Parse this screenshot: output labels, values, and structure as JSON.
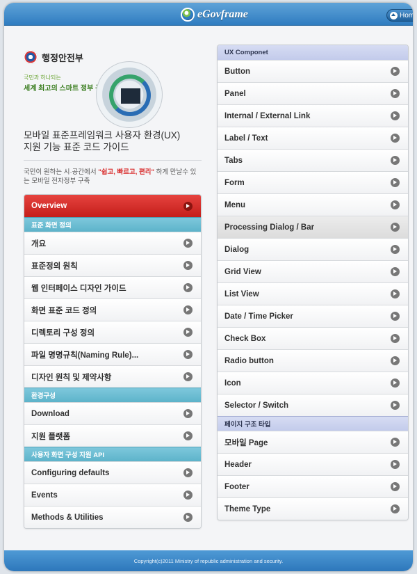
{
  "header": {
    "brand": "eGovframe",
    "home_label": "Home"
  },
  "intro": {
    "ministry": "행정안전부",
    "slogan_small": "국민과 하나되는",
    "slogan_main": "세계 최고의 스마트 정부 구현",
    "title_line1": "모바일 표준프레임워크 사용자 환경(UX)",
    "title_line2": "지원 기능 표준 코드 가이드",
    "desc_prefix": "국민이 원하는 시·공간에서 ",
    "desc_highlight": "\"쉽고, 빠르고, 편리\"",
    "desc_suffix": " 하게 만날수 있는 모바일 전자정부 구축"
  },
  "left_menu": {
    "overview": "Overview",
    "section1": "표준 화면 정의",
    "section1_items": [
      "개요",
      "표준정의 원칙",
      "웹 인터페이스 디자인 가이드",
      "화면 표준 코드 정의",
      "디렉토리 구성 정의",
      "파일 명명규칙(Naming Rule)...",
      "디자인 원칙 및 제약사항"
    ],
    "section2": "환경구성",
    "section2_items": [
      "Download",
      "지원 플랫폼"
    ],
    "section3": "사용자 화면 구성 지원 API",
    "section3_items": [
      "Configuring defaults",
      "Events",
      "Methods & Utilities"
    ]
  },
  "right_menu": {
    "section1": "UX Componet",
    "section1_items": [
      "Button",
      "Panel",
      "Internal / External Link",
      "Label / Text",
      "Tabs",
      "Form",
      "Menu",
      "Processing Dialog / Bar",
      "Dialog",
      "Grid View",
      "List View",
      "Date / Time Picker",
      "Check Box",
      "Radio button",
      "Icon",
      "Selector / Switch"
    ],
    "section2": "페이지 구조 타입",
    "section2_items": [
      "모바일 Page",
      "Header",
      "Footer",
      "Theme Type"
    ]
  },
  "footer": {
    "copyright": "Copyright(c)2011 Ministry of republic administration and security."
  },
  "colors": {
    "header_blue": "#2f7cc0",
    "active_red": "#c41e1a",
    "section_teal": "#5db3ca",
    "section_lavender": "#c3cbeb"
  }
}
